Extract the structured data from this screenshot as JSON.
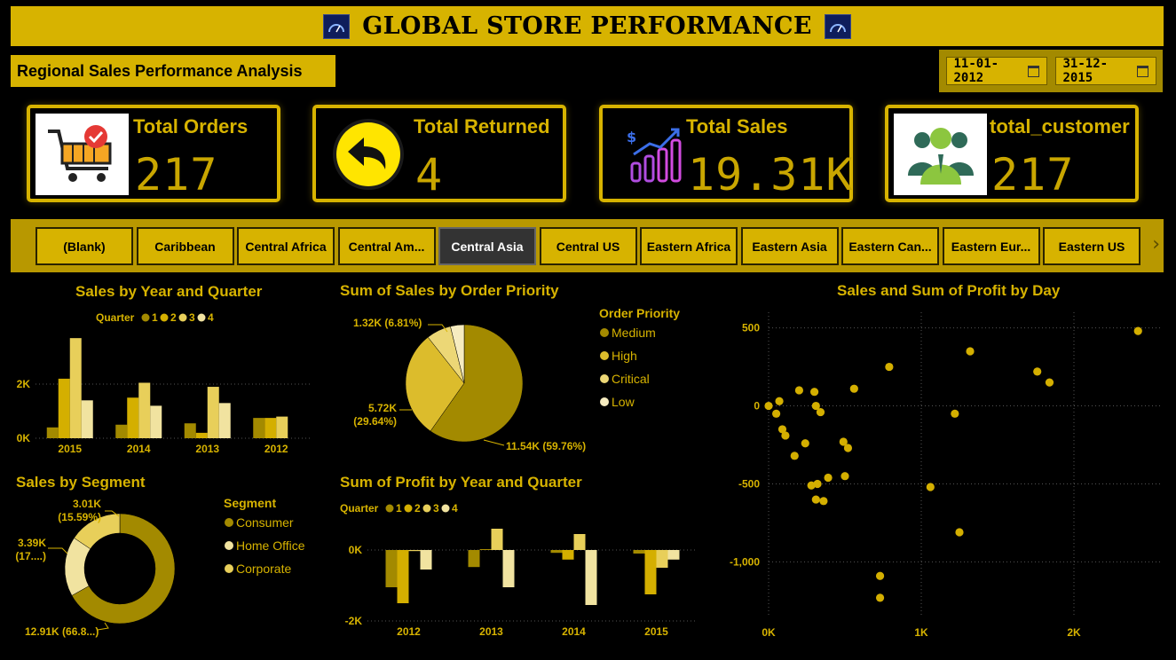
{
  "header": {
    "title": "GLOBAL STORE PERFORMANCE"
  },
  "subtitle": "Regional Sales Performance Analysis",
  "date_range": {
    "start": "11-01-2012",
    "end": "31-12-2015"
  },
  "kpis": [
    {
      "title": "Total Orders",
      "value": "217",
      "icon": "shopping-cart-icon"
    },
    {
      "title": "Total Returned",
      "value": "4",
      "icon": "return-arrow-icon"
    },
    {
      "title": "Total Sales",
      "value": "19.31K",
      "icon": "sales-growth-icon"
    },
    {
      "title": "total_customer",
      "value": "217",
      "icon": "customers-group-icon"
    }
  ],
  "regions": [
    "(Blank)",
    "Caribbean",
    "Central Africa",
    "Central Am...",
    "Central Asia",
    "Central US",
    "Eastern Africa",
    "Eastern Asia",
    "Eastern Can...",
    "Eastern Eur...",
    "Eastern US"
  ],
  "selected_region": "Central Asia",
  "colors": {
    "accent": "#d7b300",
    "q1": "#a38a00",
    "q2": "#d4af00",
    "q3": "#e8cf5a",
    "q4": "#f1e3a0"
  },
  "chart_data": [
    {
      "id": "sales_year_quarter",
      "type": "bar",
      "title": "Sales by Year and Quarter",
      "legend_title": "Quarter",
      "categories": [
        "2015",
        "2014",
        "2013",
        "2012"
      ],
      "series": [
        {
          "name": "1",
          "values": [
            400,
            500,
            550,
            750
          ]
        },
        {
          "name": "2",
          "values": [
            2200,
            1500,
            200,
            750
          ]
        },
        {
          "name": "3",
          "values": [
            3700,
            2050,
            1900,
            800
          ]
        },
        {
          "name": "4",
          "values": [
            1400,
            1200,
            1300,
            0
          ]
        }
      ],
      "yticks": [
        {
          "v": 0,
          "label": "0K"
        },
        {
          "v": 2000,
          "label": "2K"
        }
      ],
      "ylim": [
        0,
        4000
      ]
    },
    {
      "id": "sales_order_priority",
      "type": "pie",
      "title": "Sum of Sales by Order Priority",
      "legend_title": "Order Priority",
      "slices": [
        {
          "name": "Medium",
          "value": 11540,
          "label": "11.54K (59.76%)"
        },
        {
          "name": "High",
          "value": 5720,
          "label": "5.72K (29.64%)"
        },
        {
          "name": "Critical",
          "value": 1320,
          "label": "1.32K (6.81%)"
        },
        {
          "name": "Low",
          "value": 730,
          "label": ""
        }
      ]
    },
    {
      "id": "sales_profit_day",
      "type": "scatter",
      "title": "Sales and Sum of Profit by Day",
      "xticks": [
        {
          "v": 0,
          "label": "0K"
        },
        {
          "v": 1000,
          "label": "1K"
        },
        {
          "v": 2000,
          "label": "2K"
        }
      ],
      "yticks": [
        {
          "v": 500,
          "label": "500"
        },
        {
          "v": 0,
          "label": "0"
        },
        {
          "v": -500,
          "label": "-500"
        },
        {
          "v": -1000,
          "label": "-1,000"
        }
      ],
      "xlim": [
        0,
        2500
      ],
      "ylim": [
        -1350,
        600
      ],
      "points": [
        [
          0,
          0
        ],
        [
          50,
          -50
        ],
        [
          70,
          30
        ],
        [
          90,
          -150
        ],
        [
          110,
          -190
        ],
        [
          170,
          -320
        ],
        [
          200,
          100
        ],
        [
          240,
          -240
        ],
        [
          280,
          -510
        ],
        [
          300,
          90
        ],
        [
          310,
          0
        ],
        [
          310,
          -600
        ],
        [
          320,
          -500
        ],
        [
          340,
          -40
        ],
        [
          360,
          -610
        ],
        [
          390,
          -460
        ],
        [
          490,
          -230
        ],
        [
          500,
          -450
        ],
        [
          520,
          -270
        ],
        [
          560,
          110
        ],
        [
          790,
          250
        ],
        [
          730,
          -1090
        ],
        [
          730,
          -1230
        ],
        [
          1060,
          -520
        ],
        [
          1220,
          -50
        ],
        [
          1250,
          -810
        ],
        [
          1320,
          350
        ],
        [
          1760,
          220
        ],
        [
          1840,
          150
        ],
        [
          2420,
          480
        ]
      ]
    },
    {
      "id": "sales_segment",
      "type": "pie",
      "title": "Sales by Segment",
      "legend_title": "Segment",
      "slices": [
        {
          "name": "Consumer",
          "value": 12910,
          "label": "12.91K (66.8...)"
        },
        {
          "name": "Home Office",
          "value": 3390,
          "label": "3.39K (17....)"
        },
        {
          "name": "Corporate",
          "value": 3010,
          "label": "3.01K (15.59%)"
        }
      ]
    },
    {
      "id": "profit_year_quarter",
      "type": "bar",
      "title": "Sum of Profit by Year and Quarter",
      "legend_title": "Quarter",
      "categories": [
        "2012",
        "2013",
        "2014",
        "2015"
      ],
      "series": [
        {
          "name": "1",
          "values": [
            -1050,
            -480,
            -80,
            -100
          ]
        },
        {
          "name": "2",
          "values": [
            -1500,
            20,
            -270,
            -1250
          ]
        },
        {
          "name": "3",
          "values": [
            -30,
            600,
            450,
            -500
          ]
        },
        {
          "name": "4",
          "values": [
            -550,
            -1050,
            -1550,
            -270
          ]
        }
      ],
      "yticks": [
        {
          "v": 0,
          "label": "0K"
        },
        {
          "v": -2000,
          "label": "-2K"
        }
      ],
      "ylim": [
        -2000,
        800
      ]
    }
  ]
}
